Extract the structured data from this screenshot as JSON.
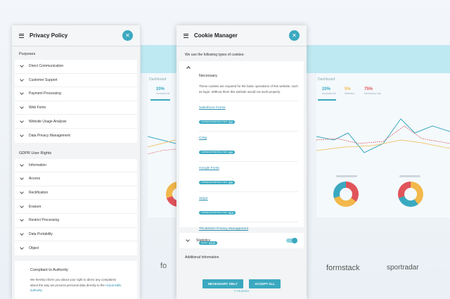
{
  "privacy_policy": {
    "title": "Privacy Policy",
    "purposes_title": "Purposes",
    "purposes": [
      "Direct Communication",
      "Customer Support",
      "Payment Processing",
      "Web Fonts",
      "Website Usage Analysis",
      "Data Privacy Management"
    ],
    "rights_title": "GDPR User Rights",
    "rights": [
      "Information",
      "Access",
      "Rectification",
      "Erasure",
      "Restrict Processing",
      "Data Portability",
      "Object"
    ],
    "compliant": {
      "title": "Compliant to Authority",
      "text": "We hereby inform you about your right to direct any complaints about the way we process personal data directly to the",
      "link": "responsible authority."
    }
  },
  "cookie_manager": {
    "title": "Cookie Manager",
    "intro": "We use the following types of cookies:",
    "necessary_title": "Necessary",
    "necessary_desc": "These cookies are required for the basic operations of this website, such as login. Without them this website would not work properly.",
    "vendors": [
      {
        "name": "Salesforce Forms",
        "tag": "COOKIES (POTENTIALLY SET)",
        "count": "9"
      },
      {
        "name": "Crisp",
        "tag": "COOKIES (POTENTIALLY SET)",
        "count": "3"
      },
      {
        "name": "Google Fonts",
        "tag": "COOKIES (POTENTIALLY SET)",
        "count": "1"
      },
      {
        "name": "Stripe",
        "tag": "COOKIES (POTENTIALLY SET)",
        "count": "17"
      },
      {
        "name": "TRUENDO Privacy Management",
        "tag": "truendo",
        "count": "1 de"
      }
    ],
    "statistics_label": "Statistics",
    "additional_label": "Additional Information",
    "btn_necessary": "NECESSARY ONLY",
    "btn_accept": "ACCEPT ALL",
    "powered": "© TRUENDO"
  },
  "background": {
    "dash_left_label": "Dashboard",
    "dash_right_label": "Dashboard",
    "left_stats": [
      {
        "value": "20%",
        "label": "Accepted All",
        "color": "#3aa9c0"
      }
    ],
    "right_stats": [
      {
        "value": "20%",
        "label": "Accepted All",
        "color": "#3aa9c0"
      },
      {
        "value": "5%",
        "label": "Statistics",
        "color": "#f2b84b"
      },
      {
        "value": "75%",
        "label": "Necessary only",
        "color": "#e0545a"
      }
    ],
    "logos": [
      "formstack",
      "sportradar",
      "fo"
    ],
    "colors": {
      "accent": "#3aa9c0",
      "red": "#e0545a",
      "yellow": "#f2b84b",
      "panel": "#f2f4f5"
    }
  }
}
